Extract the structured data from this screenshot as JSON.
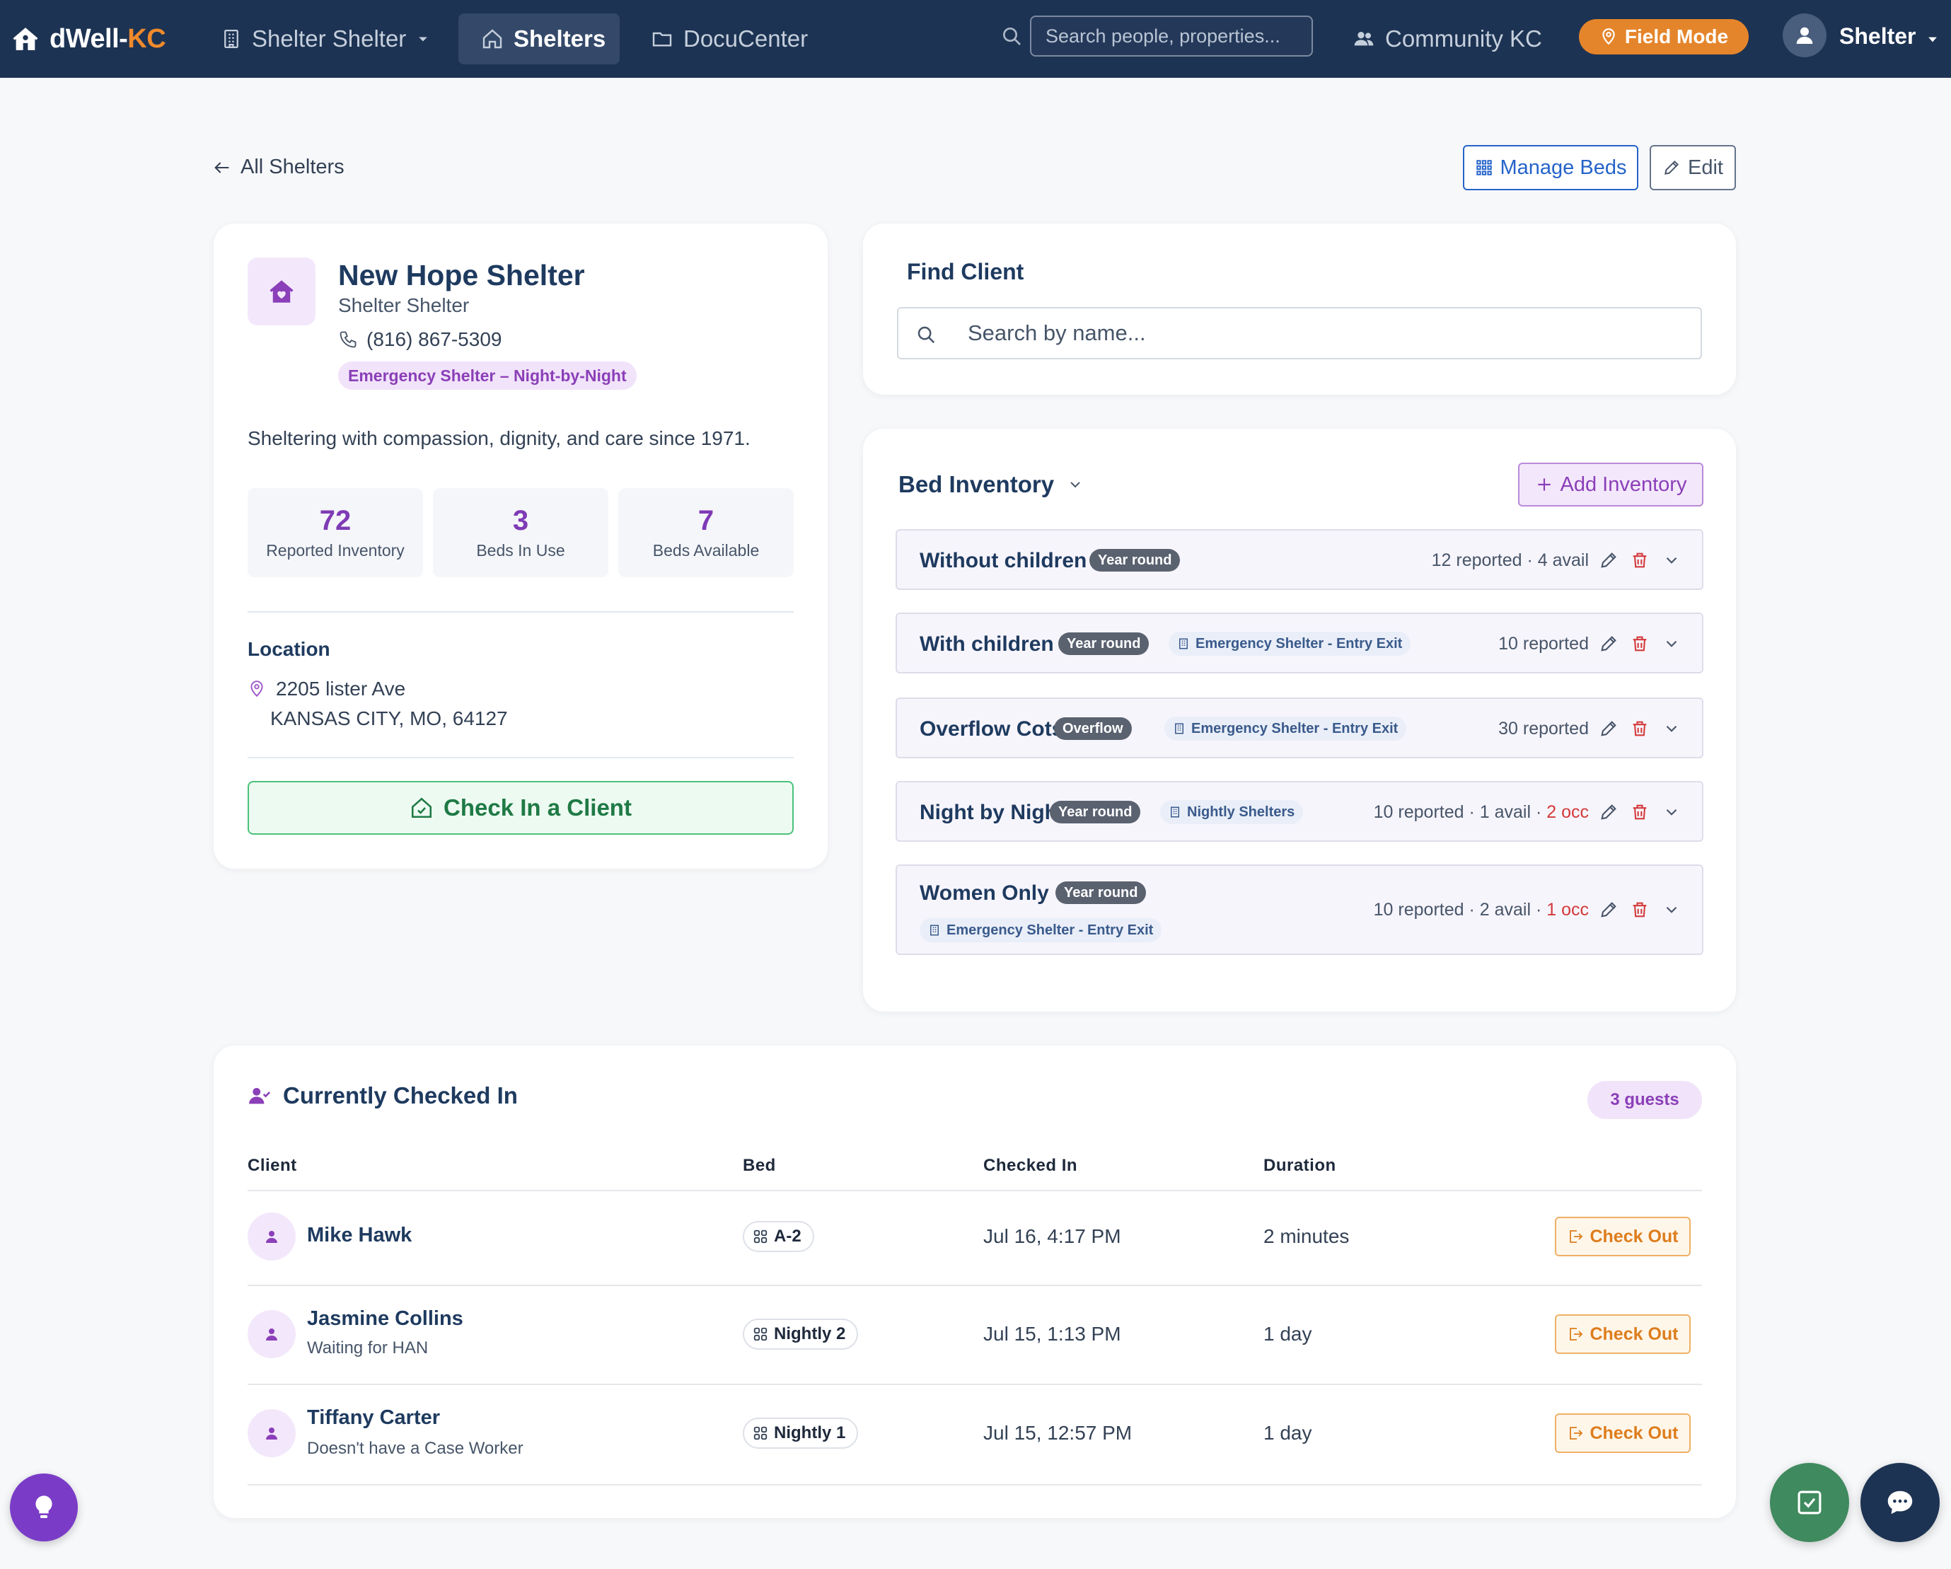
{
  "nav": {
    "brand_main": "dWell-",
    "brand_accent": "KC",
    "org_selector": "Shelter Shelter",
    "active_tab": "Shelters",
    "docucenter": "DocuCenter",
    "search_placeholder": "Search people, properties...",
    "community": "Community KC",
    "field_mode": "Field Mode",
    "user": "Shelter"
  },
  "header": {
    "back": "All Shelters",
    "manage_beds": "Manage Beds",
    "edit": "Edit"
  },
  "shelter": {
    "name": "New Hope Shelter",
    "org": "Shelter Shelter",
    "phone": "(816) 867-5309",
    "type_tag": "Emergency Shelter – Night-by-Night",
    "description": "Sheltering with compassion, dignity, and care since 1971.",
    "stats": [
      {
        "value": "72",
        "label": "Reported Inventory"
      },
      {
        "value": "3",
        "label": "Beds In Use"
      },
      {
        "value": "7",
        "label": "Beds Available"
      }
    ],
    "location_title": "Location",
    "address_line1": "2205 lister Ave",
    "address_line2": "KANSAS CITY, MO, 64127",
    "checkin_button": "Check In a Client"
  },
  "find_client": {
    "title": "Find Client",
    "placeholder": "Search by name..."
  },
  "bed_inventory": {
    "title": "Bed Inventory",
    "add_button": "Add Inventory",
    "items": [
      {
        "name": "Without children",
        "term": "Year round",
        "program": "",
        "meta": "12 reported · 4 avail",
        "occ": ""
      },
      {
        "name": "With children",
        "term": "Year round",
        "program": "Emergency Shelter - Entry Exit",
        "meta": "10 reported",
        "occ": ""
      },
      {
        "name": "Overflow Cots",
        "term": "Overflow",
        "program": "Emergency Shelter - Entry Exit",
        "meta": "30 reported",
        "occ": ""
      },
      {
        "name": "Night by Night",
        "term": "Year round",
        "program": "Nightly Shelters",
        "meta": "10 reported · 1 avail · ",
        "occ": "2 occ"
      },
      {
        "name": "Women Only",
        "term": "Year round",
        "program": "Emergency Shelter - Entry Exit",
        "meta": "10 reported · 2 avail · ",
        "occ": "1 occ"
      }
    ]
  },
  "checked_in": {
    "title": "Currently Checked In",
    "count_badge": "3 guests",
    "columns": [
      "Client",
      "Bed",
      "Checked In",
      "Duration"
    ],
    "checkout_label": "Check Out",
    "rows": [
      {
        "name": "Mike Hawk",
        "note": "",
        "bed": "A-2",
        "checked_in": "Jul 16, 4:17 PM",
        "duration": "2 minutes"
      },
      {
        "name": "Jasmine Collins",
        "note": "Waiting for HAN",
        "bed": "Nightly 2",
        "checked_in": "Jul 15, 1:13 PM",
        "duration": "1 day"
      },
      {
        "name": "Tiffany Carter",
        "note": "Doesn't have a Case Worker",
        "bed": "Nightly 1",
        "checked_in": "Jul 15, 12:57 PM",
        "duration": "1 day"
      }
    ]
  },
  "colors": {
    "nav_bg": "#1d3353",
    "accent_orange": "#e5852b",
    "accent_purple": "#7f3bb5",
    "accent_green": "#4ac27a",
    "accent_blue": "#2563c9",
    "occ_red": "#d33a3a"
  },
  "icons": {
    "brand": "home-icon",
    "org": "building-icon",
    "shelters": "home-outline-icon",
    "docucenter": "folder-icon",
    "search": "search-icon",
    "community": "users-icon",
    "field_mode": "map-pin-icon",
    "user": "user-icon",
    "idea": "lightbulb-icon",
    "tasks": "checkbox-icon",
    "chat": "chat-icon"
  }
}
